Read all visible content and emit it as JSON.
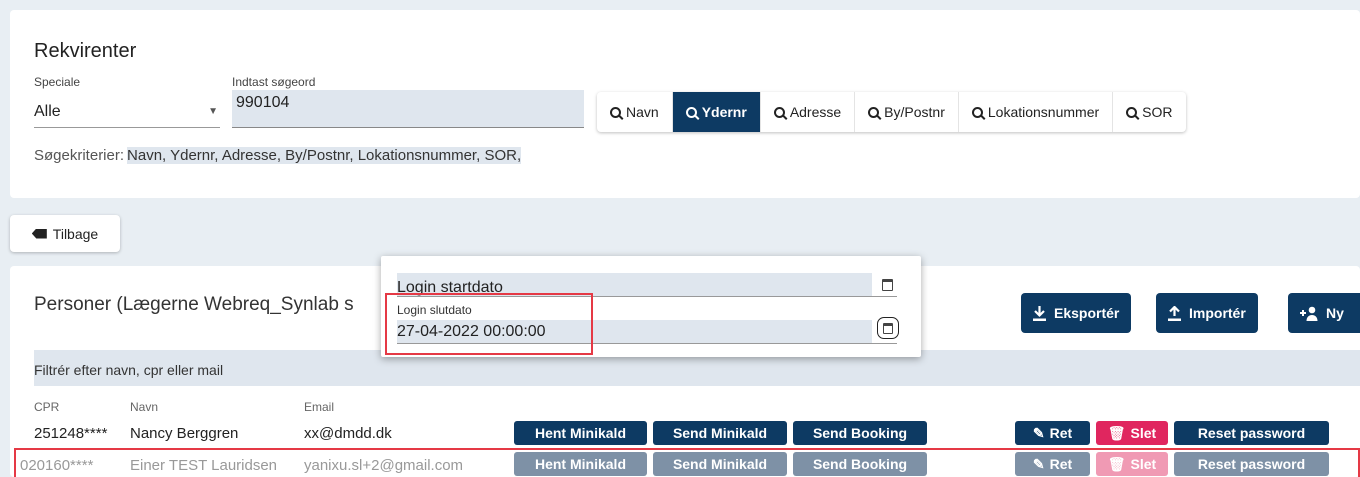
{
  "header": {
    "title": "Rekvirenter",
    "speciale_label": "Speciale",
    "speciale_value": "Alle",
    "search_label": "Indtast søgeord",
    "search_value": "990104",
    "search_buttons": [
      {
        "label": "Navn",
        "active": false
      },
      {
        "label": "Ydernr",
        "active": true
      },
      {
        "label": "Adresse",
        "active": false
      },
      {
        "label": "By/Postnr",
        "active": false
      },
      {
        "label": "Lokationsnummer",
        "active": false
      },
      {
        "label": "SOR",
        "active": false
      }
    ],
    "criteria_label": "Søgekriterier:",
    "criteria_value": "Navn, Ydernr, Adresse, By/Postnr, Lokationsnummer, SOR,"
  },
  "back_button": {
    "label": "Tilbage"
  },
  "persons": {
    "title": "Personer (Lægerne Webreq_Synlab s",
    "export_label": "Eksportér",
    "import_label": "Importér",
    "new_label": "Ny",
    "filter_placeholder": "Filtrér efter navn, cpr eller mail",
    "columns": [
      "CPR",
      "Navn",
      "Email"
    ],
    "rows": [
      {
        "cpr": "251248****",
        "name": "Nancy Berggren",
        "email": "xx@dmdd.dk"
      },
      {
        "cpr": "020160****",
        "name": "Einer TEST Lauridsen",
        "email": "yanixu.sl+2@gmail.com"
      }
    ],
    "row_buttons": {
      "hent": "Hent Minikald",
      "send": "Send Minikald",
      "booking": "Send Booking",
      "ret": "Ret",
      "slet": "Slet",
      "reset": "Reset password"
    }
  },
  "popup": {
    "start_label": "Login startdato",
    "end_label": "Login slutdato",
    "end_value": "27-04-2022 00:00:00"
  },
  "colors": {
    "primary": "#0d3a63",
    "danger": "#e0265f",
    "highlight_outline": "#e53945",
    "input_bg": "#dfe6ee"
  }
}
